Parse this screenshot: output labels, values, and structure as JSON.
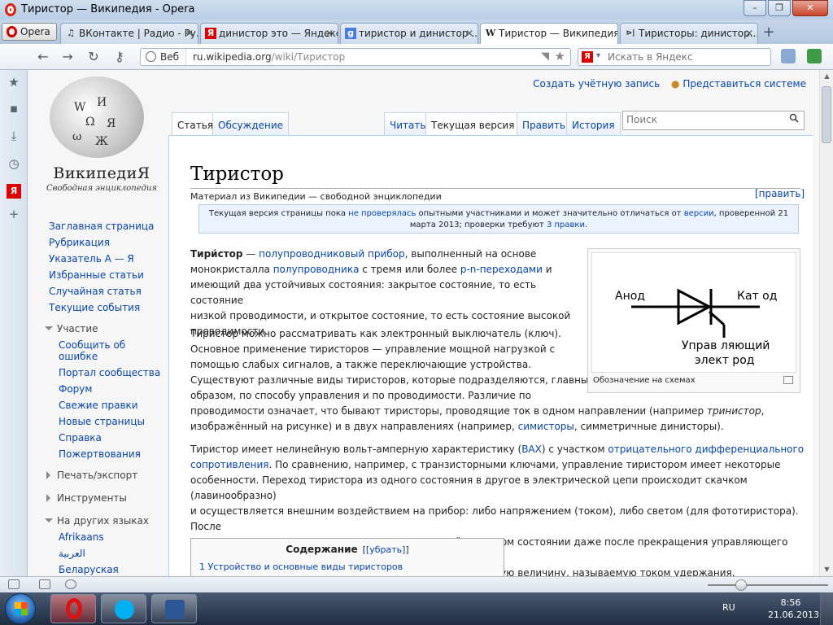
{
  "window": {
    "title": "Тиристор — Википедия - Opera"
  },
  "browser": {
    "menu_label": "Opera",
    "tabs": [
      {
        "icon": "♫",
        "label": "ВКонтакте | Радио - Ру..."
      },
      {
        "icon": "Я",
        "label": "динистор это — Яндекс..."
      },
      {
        "icon": "g",
        "label": "тиристор и динистор ..."
      },
      {
        "icon": "W",
        "label": "Тиристор — Википедия"
      },
      {
        "icon": "⊳|",
        "label": "Тиристоры: динистор..."
      }
    ],
    "address": {
      "scheme_label": "Веб",
      "domain": "ru.wikipedia.org",
      "path": "/wiki/Тиристор"
    },
    "search_placeholder": "Искать в Яндекс"
  },
  "wiki": {
    "personal": {
      "create_account": "Создать учётную запись",
      "login": "Представиться системе"
    },
    "logo_wordmark": "ВикипедиЯ",
    "logo_tagline": "Свободная энциклопедия",
    "nav": [
      "Заглавная страница",
      "Рубрикация",
      "Указатель А — Я",
      "Избранные статьи",
      "Случайная статья",
      "Текущие события"
    ],
    "participation": {
      "heading": "Участие",
      "items": [
        "Сообщить об ошибке",
        "Портал сообщества",
        "Форум",
        "Свежие правки",
        "Новые страницы",
        "Справка",
        "Пожертвования"
      ]
    },
    "print_heading": "Печать/экспорт",
    "tools_heading": "Инструменты",
    "languages": {
      "heading": "На других языках",
      "items": [
        "Afrikaans",
        "العربية",
        "Беларуская"
      ]
    },
    "tabs": {
      "article": "Статья",
      "talk": "Обсуждение",
      "read": "Читать",
      "current": "Текущая версия",
      "edit": "Править",
      "history": "История"
    },
    "search_placeholder": "Поиск",
    "article": {
      "title": "Тиристор",
      "subtitle": "Материал из Википедии — свободной энциклопедии",
      "edit_link": "[править]",
      "notice": {
        "before": "Текущая версия страницы пока ",
        "link1": "не проверялась",
        "middle": " опытными участниками и может значительно отличаться от ",
        "link2": "версии",
        "after": ", проверенной 21 марта 2013; проверки требуют ",
        "link3": "3 правки",
        "end": "."
      },
      "p1": {
        "term": "Тири́стор",
        "dash": " — ",
        "link1": "полупроводниковый прибор",
        "t1": ", выполненный на основе",
        "t2": "монокристалла ",
        "link2": "полупроводника",
        "t3": " с тремя или более ",
        "link3": "p-n-переходами",
        "t4": " и",
        "l3": "имеющий два устойчивых состояния: закрытое состояние, то есть состояние",
        "l4": "низкой проводимости, и открытое состояние, то есть состояние высокой",
        "l5": "проводимости."
      },
      "p2": {
        "l1": "Тиристор можно рассматривать как электронный выключатель (ключ).",
        "l2": "Основное применение тиристоров — управление мощной нагрузкой с",
        "l3": "помощью слабых сигналов, а также переключающие устройства.",
        "l4": "Существуют различные виды тиристоров, которые подразделяются, главным",
        "l5": "образом, по способу управления и по проводимости. Различие по",
        "l6a": "проводимости означает, что бывают тиристоры, проводящие ток в одном направлении (например ",
        "l6i": "тринистор",
        "l6b": ",",
        "l7a": "изображённый на рисунке) и в двух направлениях (например, ",
        "l7link": "симисторы",
        "l7b": ", симметричные динисторы)."
      },
      "p3": {
        "l1a": "Тиристор имеет нелинейную вольт-амперную характеристику (",
        "l1link1": "ВАХ",
        "l1b": ") с участком ",
        "l1link2": "отрицательного дифференциального",
        "l2link": "сопротивления",
        "l2b": ". По сравнению, например, с транзисторными ключами, управление тиристором имеет некоторые",
        "l3": "особенности. Переход тиристора из одного состояния в другое в электрической цепи происходит скачком (лавинообразно)",
        "l4": "и осуществляется внешним воздействием на прибор: либо напряжением (током), либо светом (для фототиристора). После",
        "l5": "перехода тиристора в открытое состояние он остаётся в этом состоянии даже после прекращения управляющего сигнала,",
        "l6": "если протекающий через тиристор ток превышает некоторую величину, называемую током удержания."
      },
      "infobox": {
        "anode": "Анод",
        "cathode": "Кат од",
        "control1": "Управ ляющий",
        "control2": "элект род",
        "caption": "Обозначение на схемах"
      },
      "toc": {
        "title": "Содержание",
        "toggle": "[убрать]",
        "item1": "1 Устройство и основные виды тиристоров"
      }
    }
  },
  "taskbar": {
    "lang": "RU",
    "time": "8:56",
    "date": "21.06.2013"
  }
}
